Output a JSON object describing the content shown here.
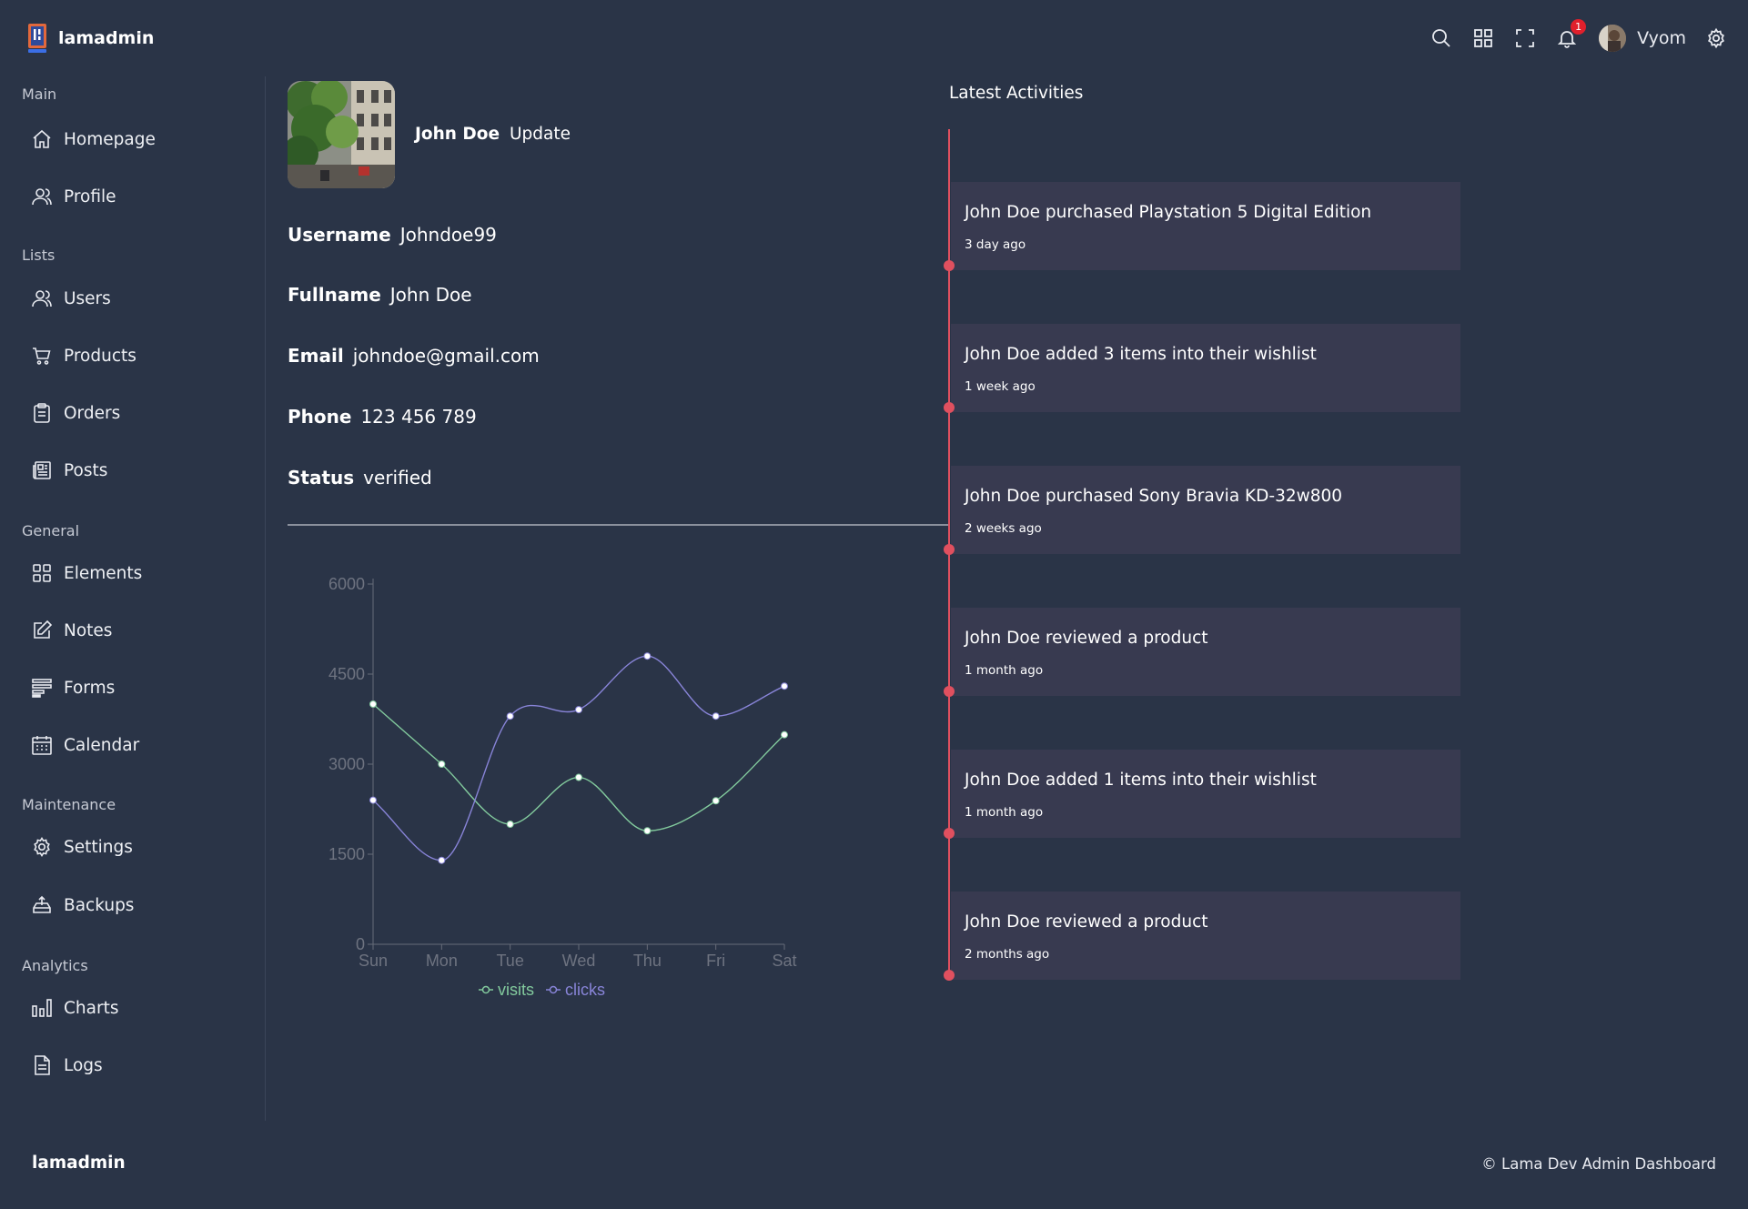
{
  "app": {
    "logo_text": "lamadmin"
  },
  "topbar": {
    "icons": [
      "search-icon",
      "apps-grid-icon",
      "fullscreen-icon",
      "bell-icon"
    ],
    "notification_count": "1",
    "user_name": "Vyom"
  },
  "sidebar": {
    "sections": [
      {
        "title": "Main",
        "items": [
          {
            "label": "Homepage",
            "icon": "home-icon"
          },
          {
            "label": "Profile",
            "icon": "user-icon"
          }
        ]
      },
      {
        "title": "Lists",
        "items": [
          {
            "label": "Users",
            "icon": "users-icon"
          },
          {
            "label": "Products",
            "icon": "cart-icon"
          },
          {
            "label": "Orders",
            "icon": "clipboard-icon"
          },
          {
            "label": "Posts",
            "icon": "newspaper-icon"
          }
        ]
      },
      {
        "title": "General",
        "items": [
          {
            "label": "Elements",
            "icon": "grid-icon"
          },
          {
            "label": "Notes",
            "icon": "edit-icon"
          },
          {
            "label": "Forms",
            "icon": "forms-icon"
          },
          {
            "label": "Calendar",
            "icon": "calendar-icon"
          }
        ]
      },
      {
        "title": "Maintenance",
        "items": [
          {
            "label": "Settings",
            "icon": "gear-icon"
          },
          {
            "label": "Backups",
            "icon": "backup-icon"
          }
        ]
      },
      {
        "title": "Analytics",
        "items": [
          {
            "label": "Charts",
            "icon": "bar-chart-icon"
          },
          {
            "label": "Logs",
            "icon": "log-file-icon"
          }
        ]
      }
    ]
  },
  "profile": {
    "name": "John Doe",
    "update_label": "Update",
    "fields": [
      {
        "key": "Username",
        "value": "Johndoe99"
      },
      {
        "key": "Fullname",
        "value": "John Doe"
      },
      {
        "key": "Email",
        "value": "johndoe@gmail.com"
      },
      {
        "key": "Phone",
        "value": "123 456 789"
      },
      {
        "key": "Status",
        "value": "verified"
      }
    ]
  },
  "chart_data": {
    "type": "line",
    "categories": [
      "Sun",
      "Mon",
      "Tue",
      "Wed",
      "Thu",
      "Fri",
      "Sat"
    ],
    "series": [
      {
        "name": "visits",
        "color": "#82ca9d",
        "values": [
          4000,
          3000,
          2000,
          2780,
          1890,
          2390,
          3490
        ]
      },
      {
        "name": "clicks",
        "color": "#8884d8",
        "values": [
          2400,
          1398,
          3800,
          3908,
          4800,
          3800,
          4300
        ]
      }
    ],
    "yticks": [
      0,
      1500,
      3000,
      4500,
      6000
    ],
    "ylim": [
      0,
      6000
    ],
    "smooth": true,
    "legend": "bottom",
    "grid": false
  },
  "activities": {
    "title": "Latest Activities",
    "items": [
      {
        "text": "John Doe purchased Playstation 5 Digital Edition",
        "time": "3 day ago"
      },
      {
        "text": "John Doe added 3 items into their wishlist",
        "time": "1 week ago"
      },
      {
        "text": "John Doe purchased Sony Bravia KD-32w800",
        "time": "2 weeks ago"
      },
      {
        "text": "John Doe reviewed a product",
        "time": "1 month ago"
      },
      {
        "text": "John Doe added 1 items into their wishlist",
        "time": "1 month ago"
      },
      {
        "text": "John Doe reviewed a product",
        "time": "2 months ago"
      }
    ]
  },
  "footer": {
    "logo_text": "lamadmin",
    "copyright": "© Lama Dev Admin Dashboard"
  },
  "colors": {
    "background": "#2a3447",
    "card": "#383a50",
    "timeline": "#e0505f",
    "badge": "#e0202c"
  }
}
